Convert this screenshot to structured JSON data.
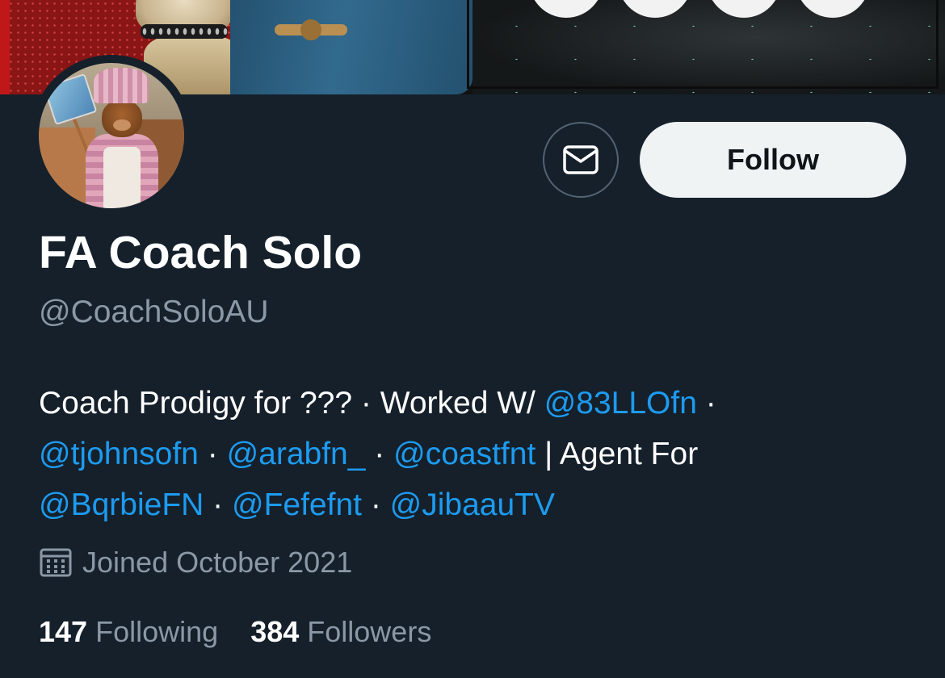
{
  "profile": {
    "display_name": "FA Coach Solo",
    "handle": "@CoachSoloAU",
    "joined": "Joined October 2021",
    "following_count": "147",
    "following_label": "Following",
    "followers_count": "384",
    "followers_label": "Followers"
  },
  "actions": {
    "message_icon": "envelope-icon",
    "follow_label": "Follow"
  },
  "bio": {
    "line1_text": "Coach Prodigy for ??? · Worked W/ ",
    "line1_mention": "@83LLOfn",
    "line1_tail": " ·",
    "line2_mention1": "@tjohnsofn",
    "line2_sep1": " · ",
    "line2_mention2": "@arabfn_",
    "line2_sep2": " · ",
    "line2_mention3": "@coastfnt",
    "line2_tail": " | Agent For",
    "line3_mention1": "@BqrbieFN",
    "line3_sep1": " · ",
    "line3_mention2": "@Fefefnt",
    "line3_sep2": " · ",
    "line3_mention3": "@JibaauTV"
  },
  "colors": {
    "background": "#15202b",
    "text_primary": "#ffffff",
    "text_secondary": "#8b98a5",
    "link": "#1d9bf0",
    "follow_button_bg": "#eff3f4"
  }
}
